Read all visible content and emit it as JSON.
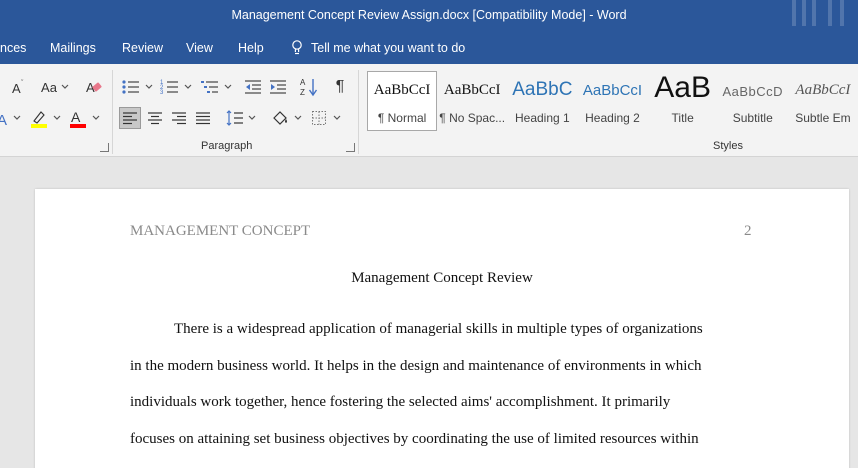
{
  "window": {
    "title": "Management Concept Review Assign.docx [Compatibility Mode]  -  Word"
  },
  "tabs": {
    "items": [
      "nces",
      "Mailings",
      "Review",
      "View",
      "Help"
    ],
    "tell_me": "Tell me what you want to do"
  },
  "ribbon": {
    "font_size_glyph": "Aa",
    "paragraph_label": "Paragraph",
    "styles_label": "Styles",
    "pilcrow": "¶",
    "styles": [
      {
        "sample": "AaBbCcI",
        "name": "¶ Normal"
      },
      {
        "sample": "AaBbCcI",
        "name": "¶ No Spac..."
      },
      {
        "sample": "AaBbC",
        "name": "Heading 1"
      },
      {
        "sample": "AaBbCcI",
        "name": "Heading 2"
      },
      {
        "sample": "AaB",
        "name": "Title"
      },
      {
        "sample": "AaBbCcD",
        "name": "Subtitle"
      },
      {
        "sample": "AaBbCcI",
        "name": "Subtle Em"
      }
    ],
    "colors": {
      "highlight": "#ffff00",
      "font_color": "#ff0000",
      "heading_blue": "#2e74b5",
      "heading2_blue": "#2e74b5"
    }
  },
  "document": {
    "header_left": "MANAGEMENT CONCEPT",
    "header_page_number": "2",
    "title": "Management Concept Review",
    "lines": [
      "There is a widespread application of managerial skills in multiple types of organizations",
      "in the modern business world. It helps in the design and maintenance of environments in which",
      "individuals work together, hence fostering the selected aims' accomplishment. It primarily",
      "focuses on attaining set business objectives by coordinating the use of limited resources within"
    ]
  }
}
